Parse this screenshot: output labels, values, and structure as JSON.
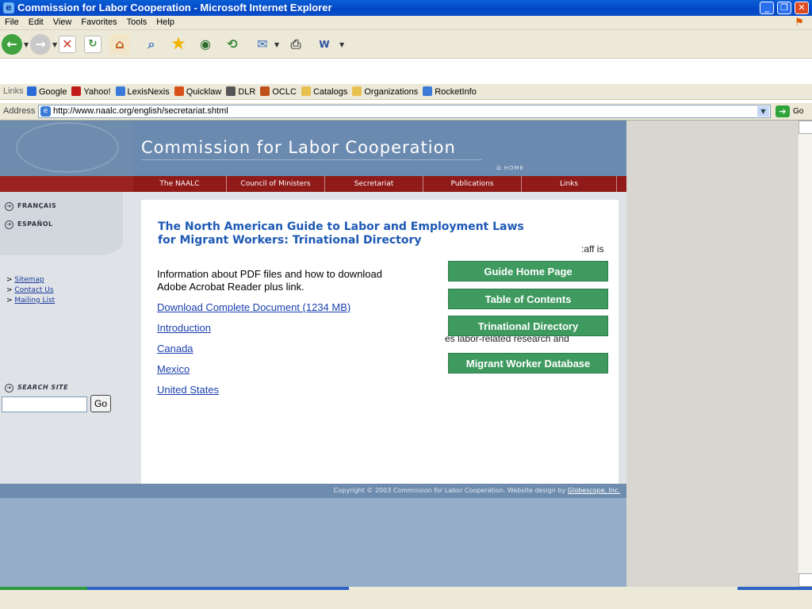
{
  "window": {
    "title": "Commission for Labor Cooperation - Microsoft Internet Explorer",
    "minimize": "_",
    "restore": "❐",
    "close": "✕"
  },
  "menu": {
    "items": [
      "File",
      "Edit",
      "View",
      "Favorites",
      "Tools",
      "Help"
    ]
  },
  "links_bar": {
    "label": "Links",
    "items": [
      {
        "label": "Google",
        "color": "#2a6ad8"
      },
      {
        "label": "Yahoo!",
        "color": "#c01a1a"
      },
      {
        "label": "LexisNexis",
        "color": "#3a7ad8"
      },
      {
        "label": "Quicklaw",
        "color": "#d8501a"
      },
      {
        "label": "DLR",
        "color": "#555555"
      },
      {
        "label": "OCLC",
        "color": "#c0501a"
      },
      {
        "label": "Catalogs",
        "color": "#e8c050"
      },
      {
        "label": "Organizations",
        "color": "#e8c050"
      },
      {
        "label": "RocketInfo",
        "color": "#3a7ad8"
      }
    ]
  },
  "address": {
    "label": "Address",
    "url": "http://www.naalc.org/english/secretariat.shtml",
    "go_label": "Go"
  },
  "site": {
    "title": "Commission for Labor Cooperation",
    "home_label": "HOME",
    "nav": [
      "The NAALC",
      "Council of Ministers",
      "Secretariat",
      "Publications",
      "Links"
    ],
    "languages": [
      "FRANÇAIS",
      "ESPAÑOL"
    ],
    "side_links": [
      "Sitemap",
      "Contact Us",
      "Mailing List"
    ],
    "search_label": "SEARCH SITE",
    "search_go": "Go",
    "accent": "#1d59b5",
    "nav_color": "#8f1a18"
  },
  "content": {
    "title_line1": "The North American Guide to Labor and Employment Laws",
    "title_line2": "for Migrant Workers:  Trinational Directory",
    "info_line1": "Information about PDF files and how to download",
    "info_line2": "Adobe Acrobat Reader plus link.",
    "links": [
      "Download Complete Document (1234 MB)",
      "Introduction",
      "Canada",
      "Mexico",
      "United States"
    ],
    "buttons": [
      "Guide Home Page",
      "Table of Contents",
      "Trinational Directory",
      "Migrant Worker Database"
    ],
    "overflow_fragments": [
      ":aff is",
      "es labor-related research and"
    ],
    "button_color": "#3f9a5f"
  },
  "footer": {
    "text": "Copyright © 2003 Commission for Labor Cooperation. Website design by ",
    "link": "Globescope, Inc."
  }
}
